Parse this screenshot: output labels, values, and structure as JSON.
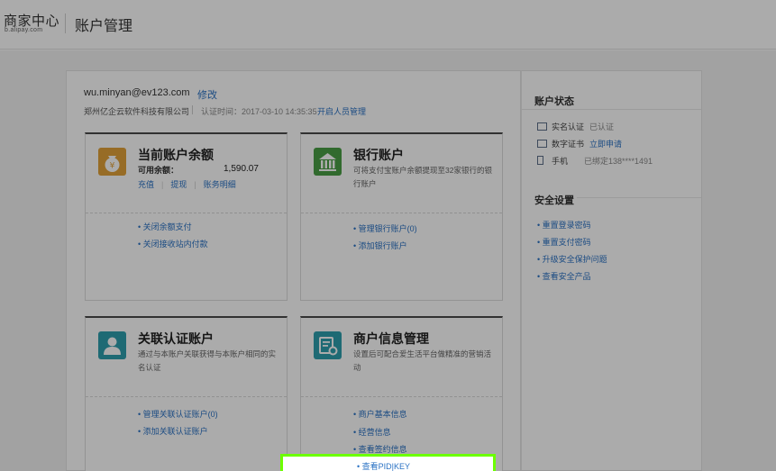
{
  "header": {
    "logo_main": "商家中心",
    "logo_sub": "b.alipay.com",
    "page_title": "账户管理"
  },
  "account": {
    "email": "wu.minyan@ev123.com",
    "edit_label": "修改",
    "company": "郑州亿企云软件科技有限公司",
    "cert_time": "认证时间：2017-03-10 14:35:35",
    "manage_link": "开启人员管理"
  },
  "cards": {
    "balance": {
      "title": "当前账户余额",
      "label": "可用余额：",
      "amount": "1,590.07",
      "actions": [
        "充值",
        "提现",
        "账务明细"
      ],
      "links": [
        "• 关闭余额支付",
        "• 关闭接收站内付款"
      ]
    },
    "bank": {
      "title": "银行账户",
      "desc": "可将支付宝账户余额提现至32家银行的银行账户",
      "links": [
        "• 管理银行账户(0)",
        "• 添加银行账户"
      ]
    },
    "linked": {
      "title": "关联认证账户",
      "desc": "通过与本账户关联获得与本账户相同的实名认证",
      "links": [
        "• 管理关联认证账户(0)",
        "• 添加关联认证账户"
      ]
    },
    "merchant": {
      "title": "商户信息管理",
      "desc": "设置后可配合爱生活平台做精准的营销活动",
      "links": [
        "• 商户基本信息",
        "• 经营信息",
        "• 查看签约信息",
        "• 查看PID|KEY"
      ]
    }
  },
  "sidebar": {
    "status_title": "账户状态",
    "status_rows": [
      {
        "label": "实名认证",
        "value": "已认证",
        "is_link": false
      },
      {
        "label": "数字证书",
        "value": "立即申请",
        "is_link": true
      },
      {
        "label": "手机",
        "value": "已绑定138****1491",
        "is_link": false
      }
    ],
    "security_title": "安全设置",
    "security_links": [
      "• 重置登录密码",
      "• 重置支付密码",
      "• 升级安全保护问题",
      "• 查看安全产品"
    ]
  },
  "colors": {
    "link": "#2a72c4",
    "balance_icon": "#e2a13a",
    "bank_icon": "#4a9e45",
    "linked_icon": "#2d9fae",
    "merchant_icon": "#2d9fae",
    "highlight": "#6cff00"
  },
  "icons": {
    "balance": "money-bag-icon",
    "bank": "bank-building-icon",
    "linked": "user-icon",
    "merchant": "settings-document-icon"
  }
}
